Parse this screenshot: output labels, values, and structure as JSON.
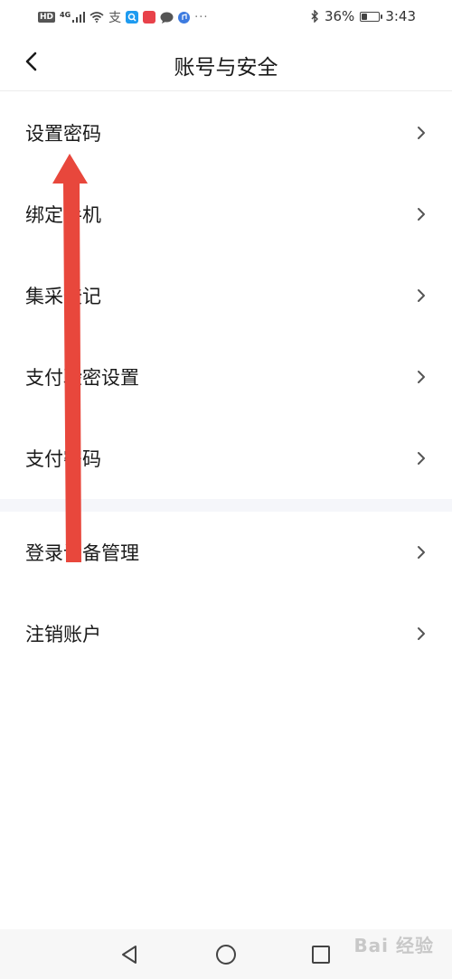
{
  "status_bar": {
    "hd": "HD",
    "network": "4G",
    "battery_percent": "36%",
    "battery_level": 0.36,
    "time": "3:43",
    "dots": "···",
    "app_icons": [
      {
        "name": "alipay-icon",
        "color": "#555555",
        "glyph": "支"
      },
      {
        "name": "search-app-icon",
        "color": "#1e9bf0",
        "glyph": ""
      },
      {
        "name": "red-app-icon",
        "color": "#e8424a",
        "glyph": ""
      },
      {
        "name": "chat-bubble-icon",
        "color": "#555555",
        "glyph": ""
      },
      {
        "name": "music-app-icon",
        "color": "#3d7be0",
        "glyph": ""
      }
    ]
  },
  "header": {
    "title": "账号与安全"
  },
  "menu_items": [
    {
      "label": "设置密码"
    },
    {
      "label": "绑定手机"
    },
    {
      "label": "集采登记"
    },
    {
      "label": "支付验密设置"
    },
    {
      "label": "支付密码"
    },
    {
      "label": "登录设备管理"
    },
    {
      "label": "注销账户"
    }
  ],
  "watermark": "Bai 经验",
  "colors": {
    "arrow": "#e8473c",
    "separator": "#f5f6fa",
    "text": "#1a1a1a",
    "chevron": "#555555"
  }
}
